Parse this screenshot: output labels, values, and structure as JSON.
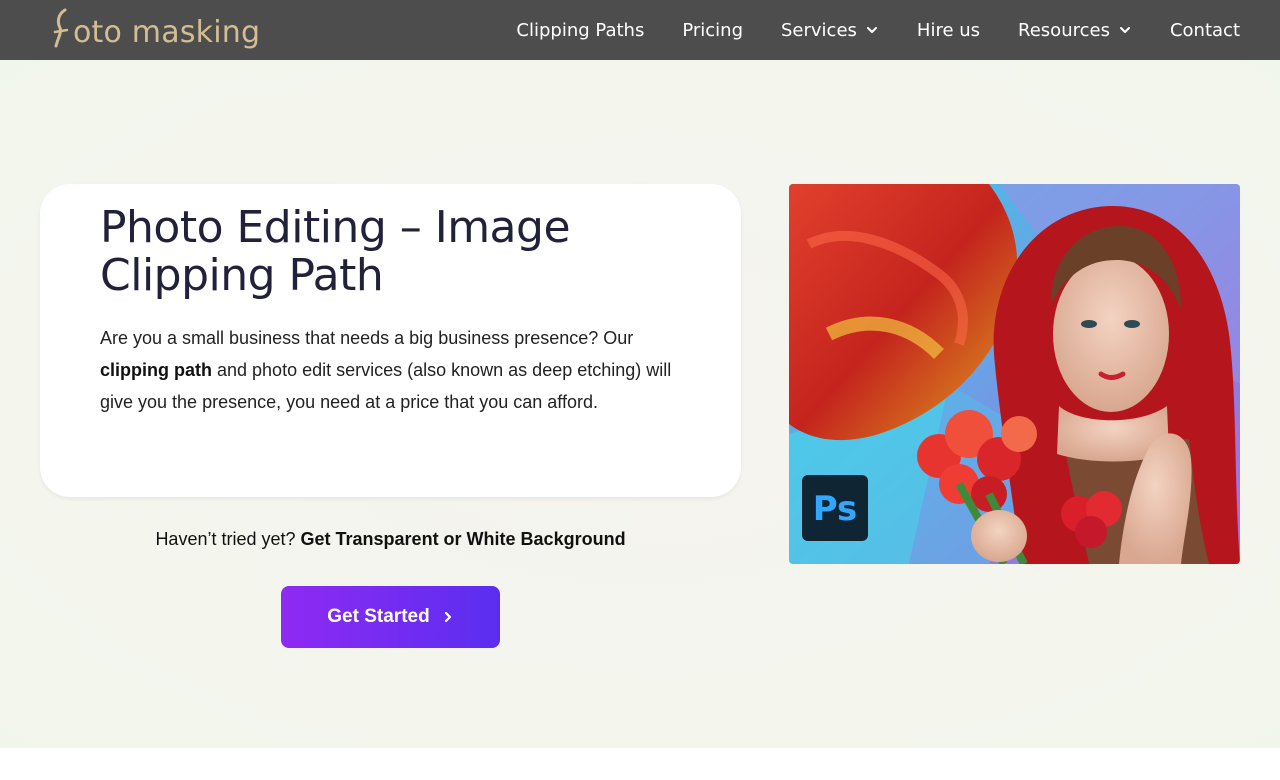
{
  "brand": {
    "logo_text": "oto masking",
    "logo_mark_icon": "f-swirl-icon",
    "logo_color": "#d4bd93"
  },
  "nav": {
    "items": [
      {
        "label": "Clipping Paths",
        "has_dropdown": false
      },
      {
        "label": "Pricing",
        "has_dropdown": false
      },
      {
        "label": "Services",
        "has_dropdown": true
      },
      {
        "label": "Hire us",
        "has_dropdown": false
      },
      {
        "label": "Resources",
        "has_dropdown": true
      },
      {
        "label": "Contact",
        "has_dropdown": false
      }
    ],
    "background": "#4d4d4d",
    "dropdown_icon": "chevron-down-icon"
  },
  "hero": {
    "title": "Photo Editing – Image Clipping Path",
    "desc_part1": "Are you a small business that needs a big business presence? Our ",
    "desc_bold": "clipping path",
    "desc_part2": " and photo edit services (also known as deep etching) will give you the presence, you need at a price that you can afford.",
    "tagline_prefix": "Haven’t tried yet? ",
    "tagline_bold": "Get Transparent or White Background",
    "cta_label": "Get Started",
    "cta_icon": "chevron-right-icon",
    "cta_gradient": [
      "#8f2af2",
      "#5a2ef0"
    ],
    "image_badge": "Ps",
    "image_icon": "photoshop-icon"
  }
}
